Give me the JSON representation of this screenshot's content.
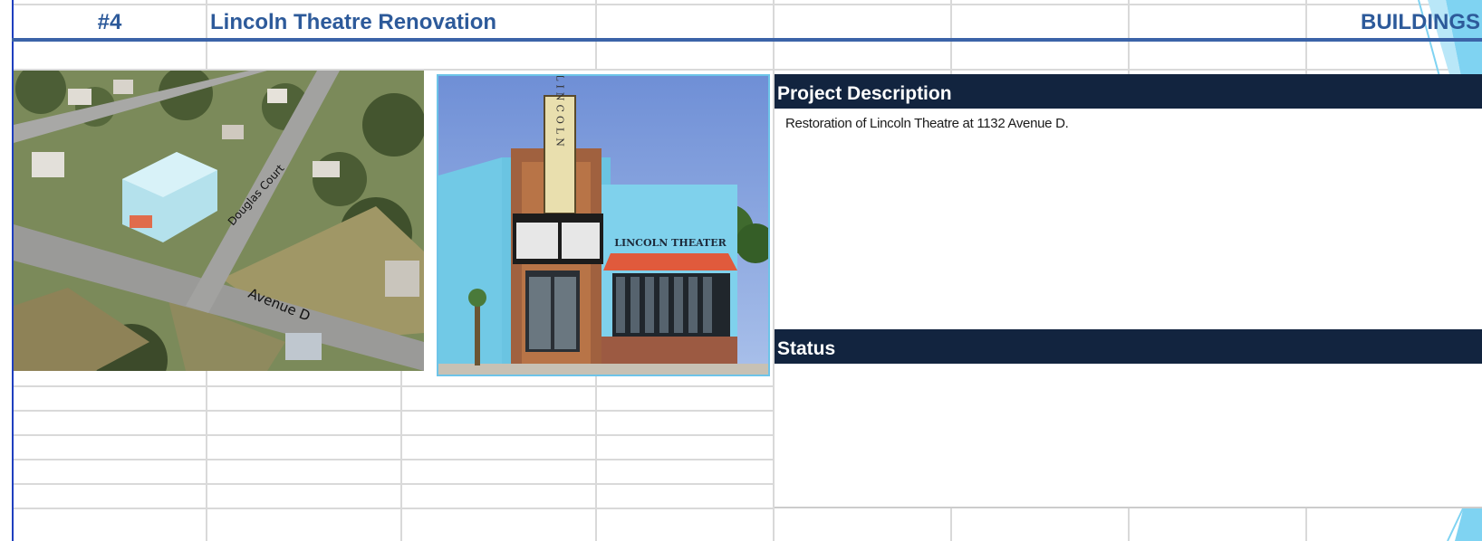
{
  "header": {
    "number": "#4",
    "title": "Lincoln Theatre Renovation",
    "category": "BUILDINGS"
  },
  "aerial": {
    "street1": "Douglas Court",
    "street2": "Avenue D"
  },
  "theatre": {
    "sign_vertical": "LINCOLN",
    "sign_horizontal": "LINCOLN THEATER"
  },
  "sections": {
    "description_title": "Project Description",
    "description_text": "Restoration of Lincoln Theatre at 1132  Avenue D.",
    "status_title": "Status",
    "status_text": ""
  },
  "colors": {
    "header_text": "#2d5a9a",
    "section_bg": "#12243f",
    "accent_line": "#3b63a8"
  }
}
